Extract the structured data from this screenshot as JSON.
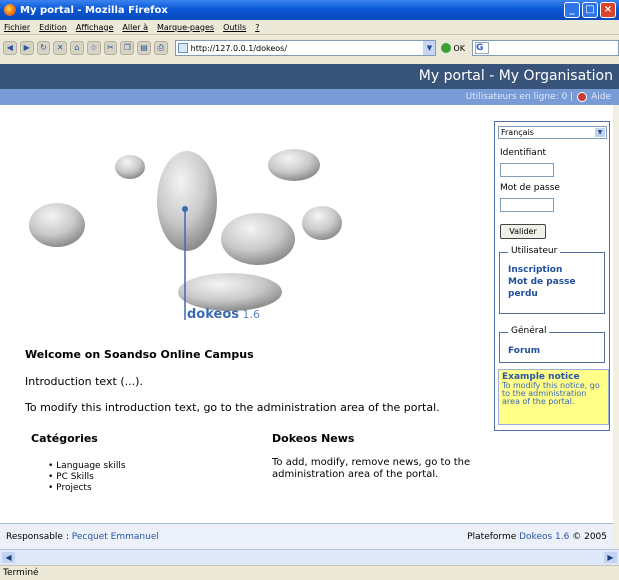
{
  "window": {
    "title": "My portal - Mozilla Firefox"
  },
  "menu": [
    "Fichier",
    "Edition",
    "Affichage",
    "Aller à",
    "Marque-pages",
    "Outils",
    "?"
  ],
  "browser": {
    "url": "http://127.0.0.1/dokeos/",
    "go_label": "OK",
    "search_icon": "G"
  },
  "header": {
    "title": "My portal - My Organisation",
    "online_users": "Utilisateurs en ligne: 0 |",
    "help": "Aide"
  },
  "hero": {
    "brand": "dokeos",
    "version": "1.6"
  },
  "main": {
    "welcome": "Welcome on Soandso Online Campus",
    "intro": "Introduction text (...).",
    "modify": "To modify this introduction text, go to the administration area of the portal.",
    "categories_title": "Catégories",
    "categories": [
      "Language skills",
      "PC Skills",
      "Projects"
    ],
    "news_title": "Dokeos News",
    "news_text": "To add, modify, remove news, go to the administration area of the portal."
  },
  "sidebar": {
    "language": "Français",
    "login_label": "Identifiant",
    "password_label": "Mot de passe",
    "submit": "Valider",
    "user_legend": "Utilisateur",
    "register_link": "Inscription",
    "lost_password_link": "Mot de passe perdu",
    "general_legend": "Général",
    "forum_link": "Forum",
    "notice_title": "Example notice",
    "notice_text": "To modify this notice, go to the administration area of the portal."
  },
  "footer": {
    "manager_label": "Responsable :",
    "manager_name": "Pecquet Emmanuel",
    "platform_label": "Plateforme",
    "platform_name": "Dokeos 1.6",
    "copyright": "© 2005"
  },
  "status": "Terminé",
  "colors": {
    "header": "#39547b",
    "subheader": "#7a9cd6",
    "link": "#1f4f9f",
    "notice_bg": "#ffff8a"
  }
}
